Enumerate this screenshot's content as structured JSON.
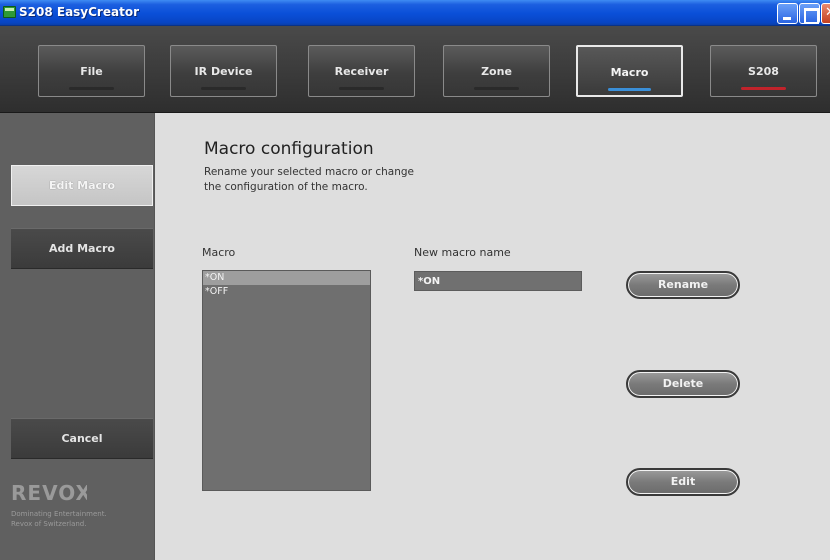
{
  "window": {
    "title": "S208 EasyCreator"
  },
  "topnav": {
    "tabs": [
      {
        "label": "File",
        "active": false
      },
      {
        "label": "IR Device",
        "active": false
      },
      {
        "label": "Receiver",
        "active": false
      },
      {
        "label": "Zone",
        "active": false
      },
      {
        "label": "Macro",
        "active": true
      },
      {
        "label": "S208",
        "active": false
      }
    ]
  },
  "sidebar": {
    "edit_macro": "Edit Macro",
    "add_macro": "Add Macro",
    "cancel": "Cancel",
    "logo_text": "REVOX",
    "logo_tagline_1": "Dominating Entertainment.",
    "logo_tagline_2": "Revox of Switzerland."
  },
  "main": {
    "heading": "Macro configuration",
    "description_line1": "Rename your selected macro or change",
    "description_line2": "the configuration of the macro.",
    "macro_label": "Macro",
    "new_name_label": "New macro name",
    "macros": [
      "*ON",
      "*OFF"
    ],
    "selected_macro": "*ON",
    "new_name_value": "*ON",
    "buttons": {
      "rename": "Rename",
      "delete": "Delete",
      "edit": "Edit"
    }
  },
  "colors": {
    "macro_indicator": "#3a8fd8",
    "s208_indicator": "#c1232b",
    "titlebar": "#0a4fd8"
  }
}
